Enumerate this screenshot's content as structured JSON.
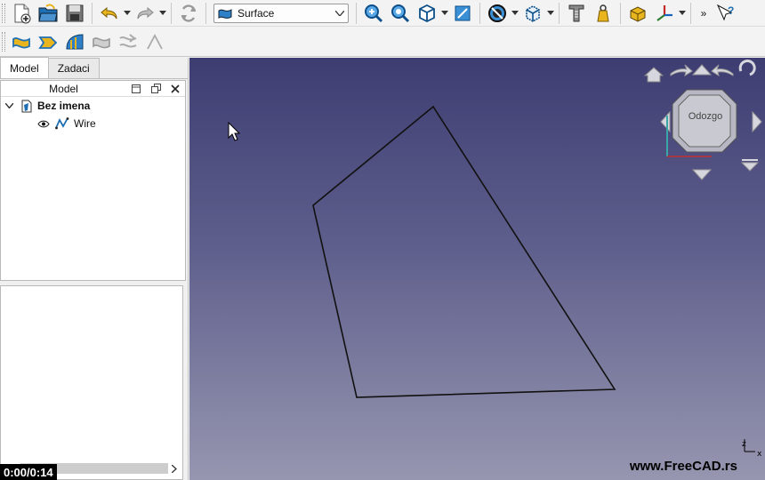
{
  "toolbar": {
    "workbench": "Surface",
    "more_label": "»"
  },
  "tabs": [
    {
      "label": "Model",
      "active": true
    },
    {
      "label": "Zadaci",
      "active": false
    }
  ],
  "tree": {
    "header": "Model",
    "document": "Bez imena",
    "items": [
      {
        "label": "Wire"
      }
    ]
  },
  "navcube": {
    "face_label": "Odozgo"
  },
  "viewport": {
    "watermark": "www.FreeCAD.rs",
    "axis_z": "z",
    "axis_x": "x"
  },
  "video": {
    "timer": "0:00/0:14"
  },
  "colors": {
    "bg_top": "#3e3d72",
    "bg_bottom": "#9696b0",
    "wire": "#111111",
    "icon_blue": "#1f6fb4",
    "icon_yellow": "#e8b51f"
  }
}
